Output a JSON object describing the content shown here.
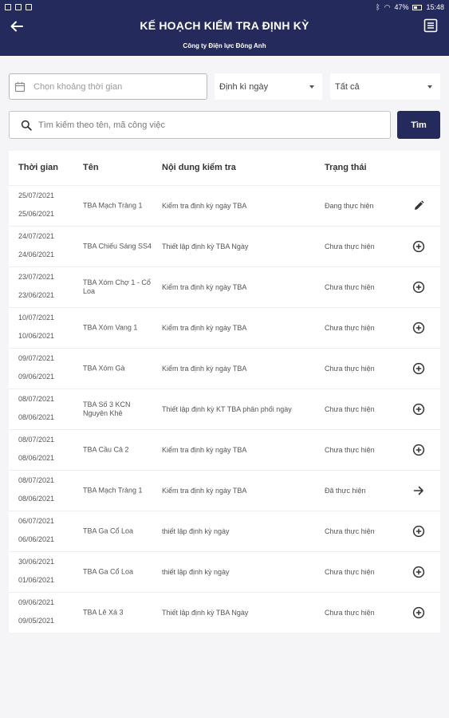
{
  "status_bar": {
    "time": "15:48",
    "battery": "47%"
  },
  "header": {
    "title": "KẾ HOẠCH KIỂM TRA ĐỊNH KỲ",
    "subtitle": "Công ty Điện lực Đông Anh",
    "back_icon": "arrow-left-icon",
    "menu_icon": "list-icon"
  },
  "filters": {
    "date_placeholder": "Chọn khoảng thời gian",
    "period_value": "Định kì ngày",
    "status_value": "Tất cả"
  },
  "search": {
    "placeholder": "Tìm kiếm theo tên, mã công việc",
    "button_label": "Tìm"
  },
  "table": {
    "headers": [
      "Thời gian",
      "Tên",
      "Nội dung kiểm tra",
      "Trạng thái"
    ],
    "rows": [
      {
        "date_to": "25/07/2021",
        "date_from": "25/06/2021",
        "name": "TBA Mạch Tràng 1",
        "content": "Kiểm tra định kỳ ngày TBA",
        "status": "Đang thực hiện",
        "action": "pencil-icon"
      },
      {
        "date_to": "24/07/2021",
        "date_from": "24/06/2021",
        "name": "TBA Chiếu Sáng SS4",
        "content": "Thiết lập định kỳ TBA Ngày",
        "status": "Chưa thực hiện",
        "action": "plus-circle-icon"
      },
      {
        "date_to": "23/07/2021",
        "date_from": "23/06/2021",
        "name": "TBA Xóm Chợ 1 - Cổ Loa",
        "content": "Kiểm tra định kỳ ngày TBA",
        "status": "Chưa thực hiện",
        "action": "plus-circle-icon"
      },
      {
        "date_to": "10/07/2021",
        "date_from": "10/06/2021",
        "name": "TBA Xóm Vang 1",
        "content": "Kiểm tra định kỳ ngày TBA",
        "status": "Chưa thực hiện",
        "action": "plus-circle-icon"
      },
      {
        "date_to": "09/07/2021",
        "date_from": "09/06/2021",
        "name": "TBA Xóm Gà",
        "content": "Kiểm tra định kỳ ngày TBA",
        "status": "Chưa thực hiện",
        "action": "plus-circle-icon"
      },
      {
        "date_to": "08/07/2021",
        "date_from": "08/06/2021",
        "name": "TBA Số 3 KCN Nguyên Khê",
        "content": "Thiết lập định kỳ KT TBA phân phối ngày",
        "status": "Chưa thực hiện",
        "action": "plus-circle-icon"
      },
      {
        "date_to": "08/07/2021",
        "date_from": "08/06/2021",
        "name": "TBA Cầu Cả 2",
        "content": "Kiểm tra định kỳ ngày TBA",
        "status": "Chưa thực hiện",
        "action": "plus-circle-icon"
      },
      {
        "date_to": "08/07/2021",
        "date_from": "08/06/2021",
        "name": "TBA Mạch Tràng 1",
        "content": "Kiểm tra định kỳ ngày TBA",
        "status": "Đã thực hiện",
        "action": "arrow-right-icon"
      },
      {
        "date_to": "06/07/2021",
        "date_from": "06/06/2021",
        "name": "TBA Ga Cổ Loa",
        "content": "thiết lập định kỳ ngày",
        "status": "Chưa thực hiện",
        "action": "plus-circle-icon"
      },
      {
        "date_to": "30/06/2021",
        "date_from": "01/06/2021",
        "name": "TBA Ga Cổ Loa",
        "content": "thiết lập định kỳ ngày",
        "status": "Chưa thực hiện",
        "action": "plus-circle-icon"
      },
      {
        "date_to": "09/06/2021",
        "date_from": "09/05/2021",
        "name": "TBA Lê Xá 3",
        "content": "Thiết lập định kỳ TBA Ngày",
        "status": "Chưa thực hiện",
        "action": "plus-circle-icon"
      }
    ]
  }
}
